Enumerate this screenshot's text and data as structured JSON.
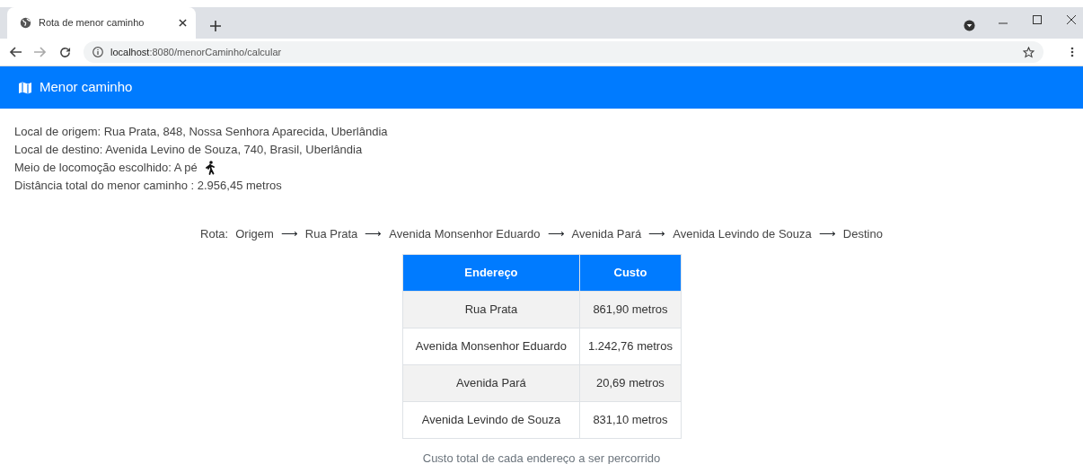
{
  "browser": {
    "tab_title": "Rota de menor caminho",
    "url_host": "localhost",
    "url_path": ":8080/menorCaminho/calcular"
  },
  "navbar": {
    "brand": "Menor caminho"
  },
  "info": [
    {
      "text": "Local de origem: Rua Prata, 848, Nossa Senhora Aparecida, Uberlândia",
      "kind": "text"
    },
    {
      "text": "Local de destino: Avenida Levino de Souza, 740, Brasil, Uberlândia",
      "kind": "text"
    },
    {
      "text": "Meio de locomoção escolhido: A pé",
      "kind": "walk"
    },
    {
      "text": "Distância total do menor caminho : 2.956,45 metros",
      "kind": "text"
    }
  ],
  "route": {
    "label": "Rota:",
    "separator": "⟶",
    "stops": [
      "Origem",
      "Rua Prata",
      "Avenida Monsenhor Eduardo",
      "Avenida Pará",
      "Avenida Levindo de Souza",
      "Destino"
    ]
  },
  "table": {
    "columns": [
      "Endereço",
      "Custo"
    ],
    "rows": [
      [
        "Rua Prata",
        "861,90 metros"
      ],
      [
        "Avenida Monsenhor Eduardo",
        "1.242,76 metros"
      ],
      [
        "Avenida Pará",
        "20,69 metros"
      ],
      [
        "Avenida Levindo de Souza",
        "831,10 metros"
      ]
    ],
    "caption": "Custo total de cada endereço a ser percorrido"
  }
}
